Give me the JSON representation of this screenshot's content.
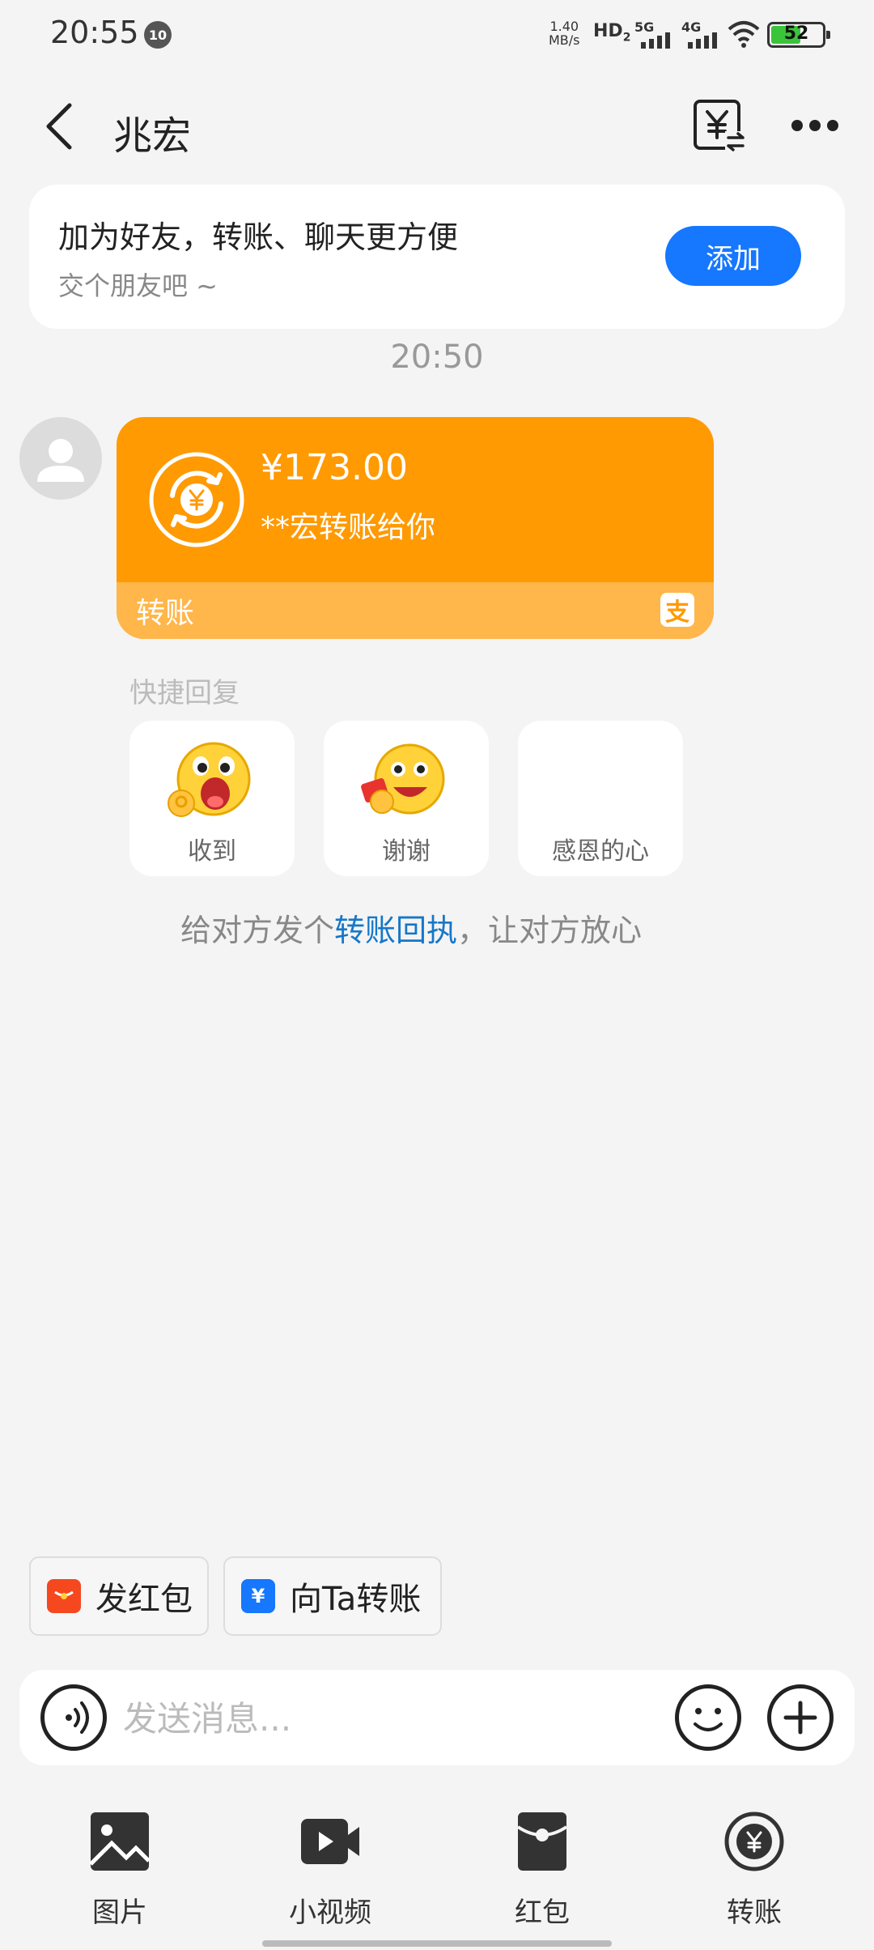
{
  "status_bar": {
    "time": "20:55",
    "notification_count": "10",
    "net_speed_value": "1.40",
    "net_speed_unit": "MB/s",
    "hd_label": "HD",
    "hd_sub": "2",
    "signal1_label": "5G",
    "signal2_label": "4G",
    "battery": "52"
  },
  "header": {
    "title": "兆宏"
  },
  "friend_card": {
    "title": "加为好友，转账、聊天更方便",
    "subtitle": "交个朋友吧 ~",
    "add_label": "添加"
  },
  "chat": {
    "timestamp": "20:50",
    "transfer": {
      "amount": "¥173.00",
      "from": "**宏转账给你",
      "label": "转账",
      "alipay_glyph": "支"
    },
    "quick_reply_label": "快捷回复",
    "quick_replies": [
      {
        "label": "收到",
        "icon": "ok-emoji-icon"
      },
      {
        "label": "谢谢",
        "icon": "thanks-emoji-icon"
      },
      {
        "label": "感恩的心",
        "icon": "heart-emoji-icon"
      }
    ],
    "hint_prefix": "给对方发个",
    "hint_link": "转账回执",
    "hint_suffix": "，让对方放心"
  },
  "actions": {
    "red_packet": "发红包",
    "transfer": "向Ta转账"
  },
  "input": {
    "placeholder": "发送消息..."
  },
  "toolbar": {
    "items": [
      {
        "label": "图片",
        "icon": "image-icon"
      },
      {
        "label": "小视频",
        "icon": "video-icon"
      },
      {
        "label": "红包",
        "icon": "red-packet-icon"
      },
      {
        "label": "转账",
        "icon": "transfer-icon"
      }
    ]
  },
  "colors": {
    "accent": "#1677ff",
    "transfer_orange": "#ff9a02",
    "transfer_orange_light": "#ffb64a",
    "red_packet": "#f5481f"
  }
}
